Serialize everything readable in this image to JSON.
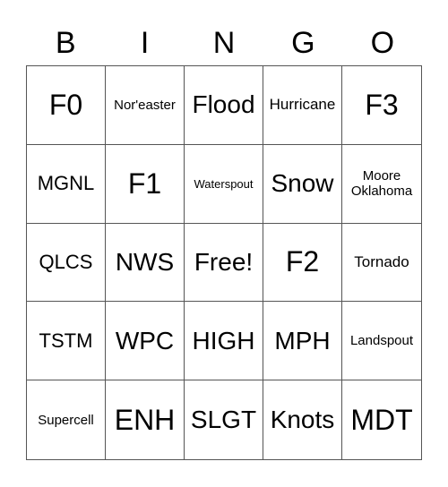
{
  "header": [
    "B",
    "I",
    "N",
    "G",
    "O"
  ],
  "cells": [
    "F0",
    "Nor'easter",
    "Flood",
    "Hurricane",
    "F3",
    "MGNL",
    "F1",
    "Waterspout",
    "Snow",
    "Moore Oklahoma",
    "QLCS",
    "NWS",
    "Free!",
    "F2",
    "Tornado",
    "TSTM",
    "WPC",
    "HIGH",
    "MPH",
    "Landspout",
    "Supercell",
    "ENH",
    "SLGT",
    "Knots",
    "MDT"
  ]
}
